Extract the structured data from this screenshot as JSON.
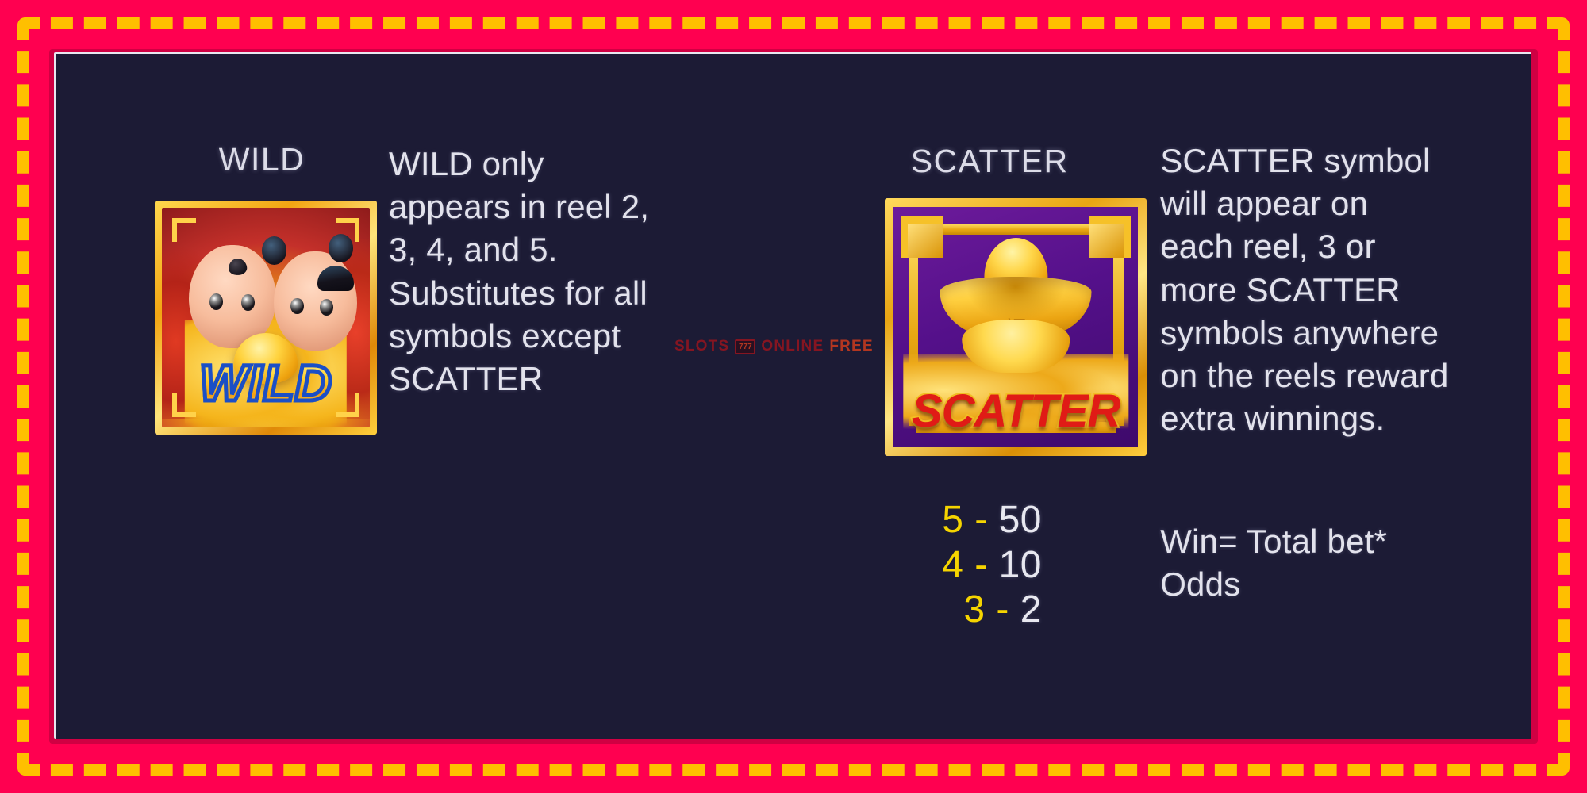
{
  "theme": {
    "frame_color": "#FF0050",
    "dash_color": "#FFBF00",
    "bevel_color": "#D00043",
    "panel_color": "#1C1B35",
    "text_color": "#E2E2EC",
    "accent_yellow": "#F5D400",
    "gold": "#FFD24A",
    "scatter_red": "#E01B16",
    "scatter_purple": "#54108A"
  },
  "wild": {
    "heading": "WILD",
    "symbol_word": "WILD",
    "description_lines": [
      "WILD only",
      "appears in reel 2,",
      "3, 4, and 5.",
      "Substitutes for all",
      "symbols except",
      "SCATTER"
    ]
  },
  "scatter": {
    "heading": "SCATTER",
    "symbol_word": "SCATTER",
    "ingot_glyph": "福",
    "description_lines": [
      "SCATTER symbol",
      "will appear on",
      "each reel, 3 or",
      "more SCATTER",
      "symbols anywhere",
      "on the reels reward",
      "extra winnings."
    ],
    "paytable": [
      {
        "count": "5",
        "dash": "-",
        "value": "50"
      },
      {
        "count": "4",
        "dash": "-",
        "value": "10"
      },
      {
        "count": "3",
        "dash": "-",
        "value": "2"
      }
    ],
    "win_formula_lines": [
      "Win= Total bet*",
      "Odds"
    ]
  },
  "watermark": {
    "text_left": "SLOTS",
    "icon": "slot-machine-777-icon",
    "text_mid": "ONLINE",
    "text_right": "FREE"
  }
}
